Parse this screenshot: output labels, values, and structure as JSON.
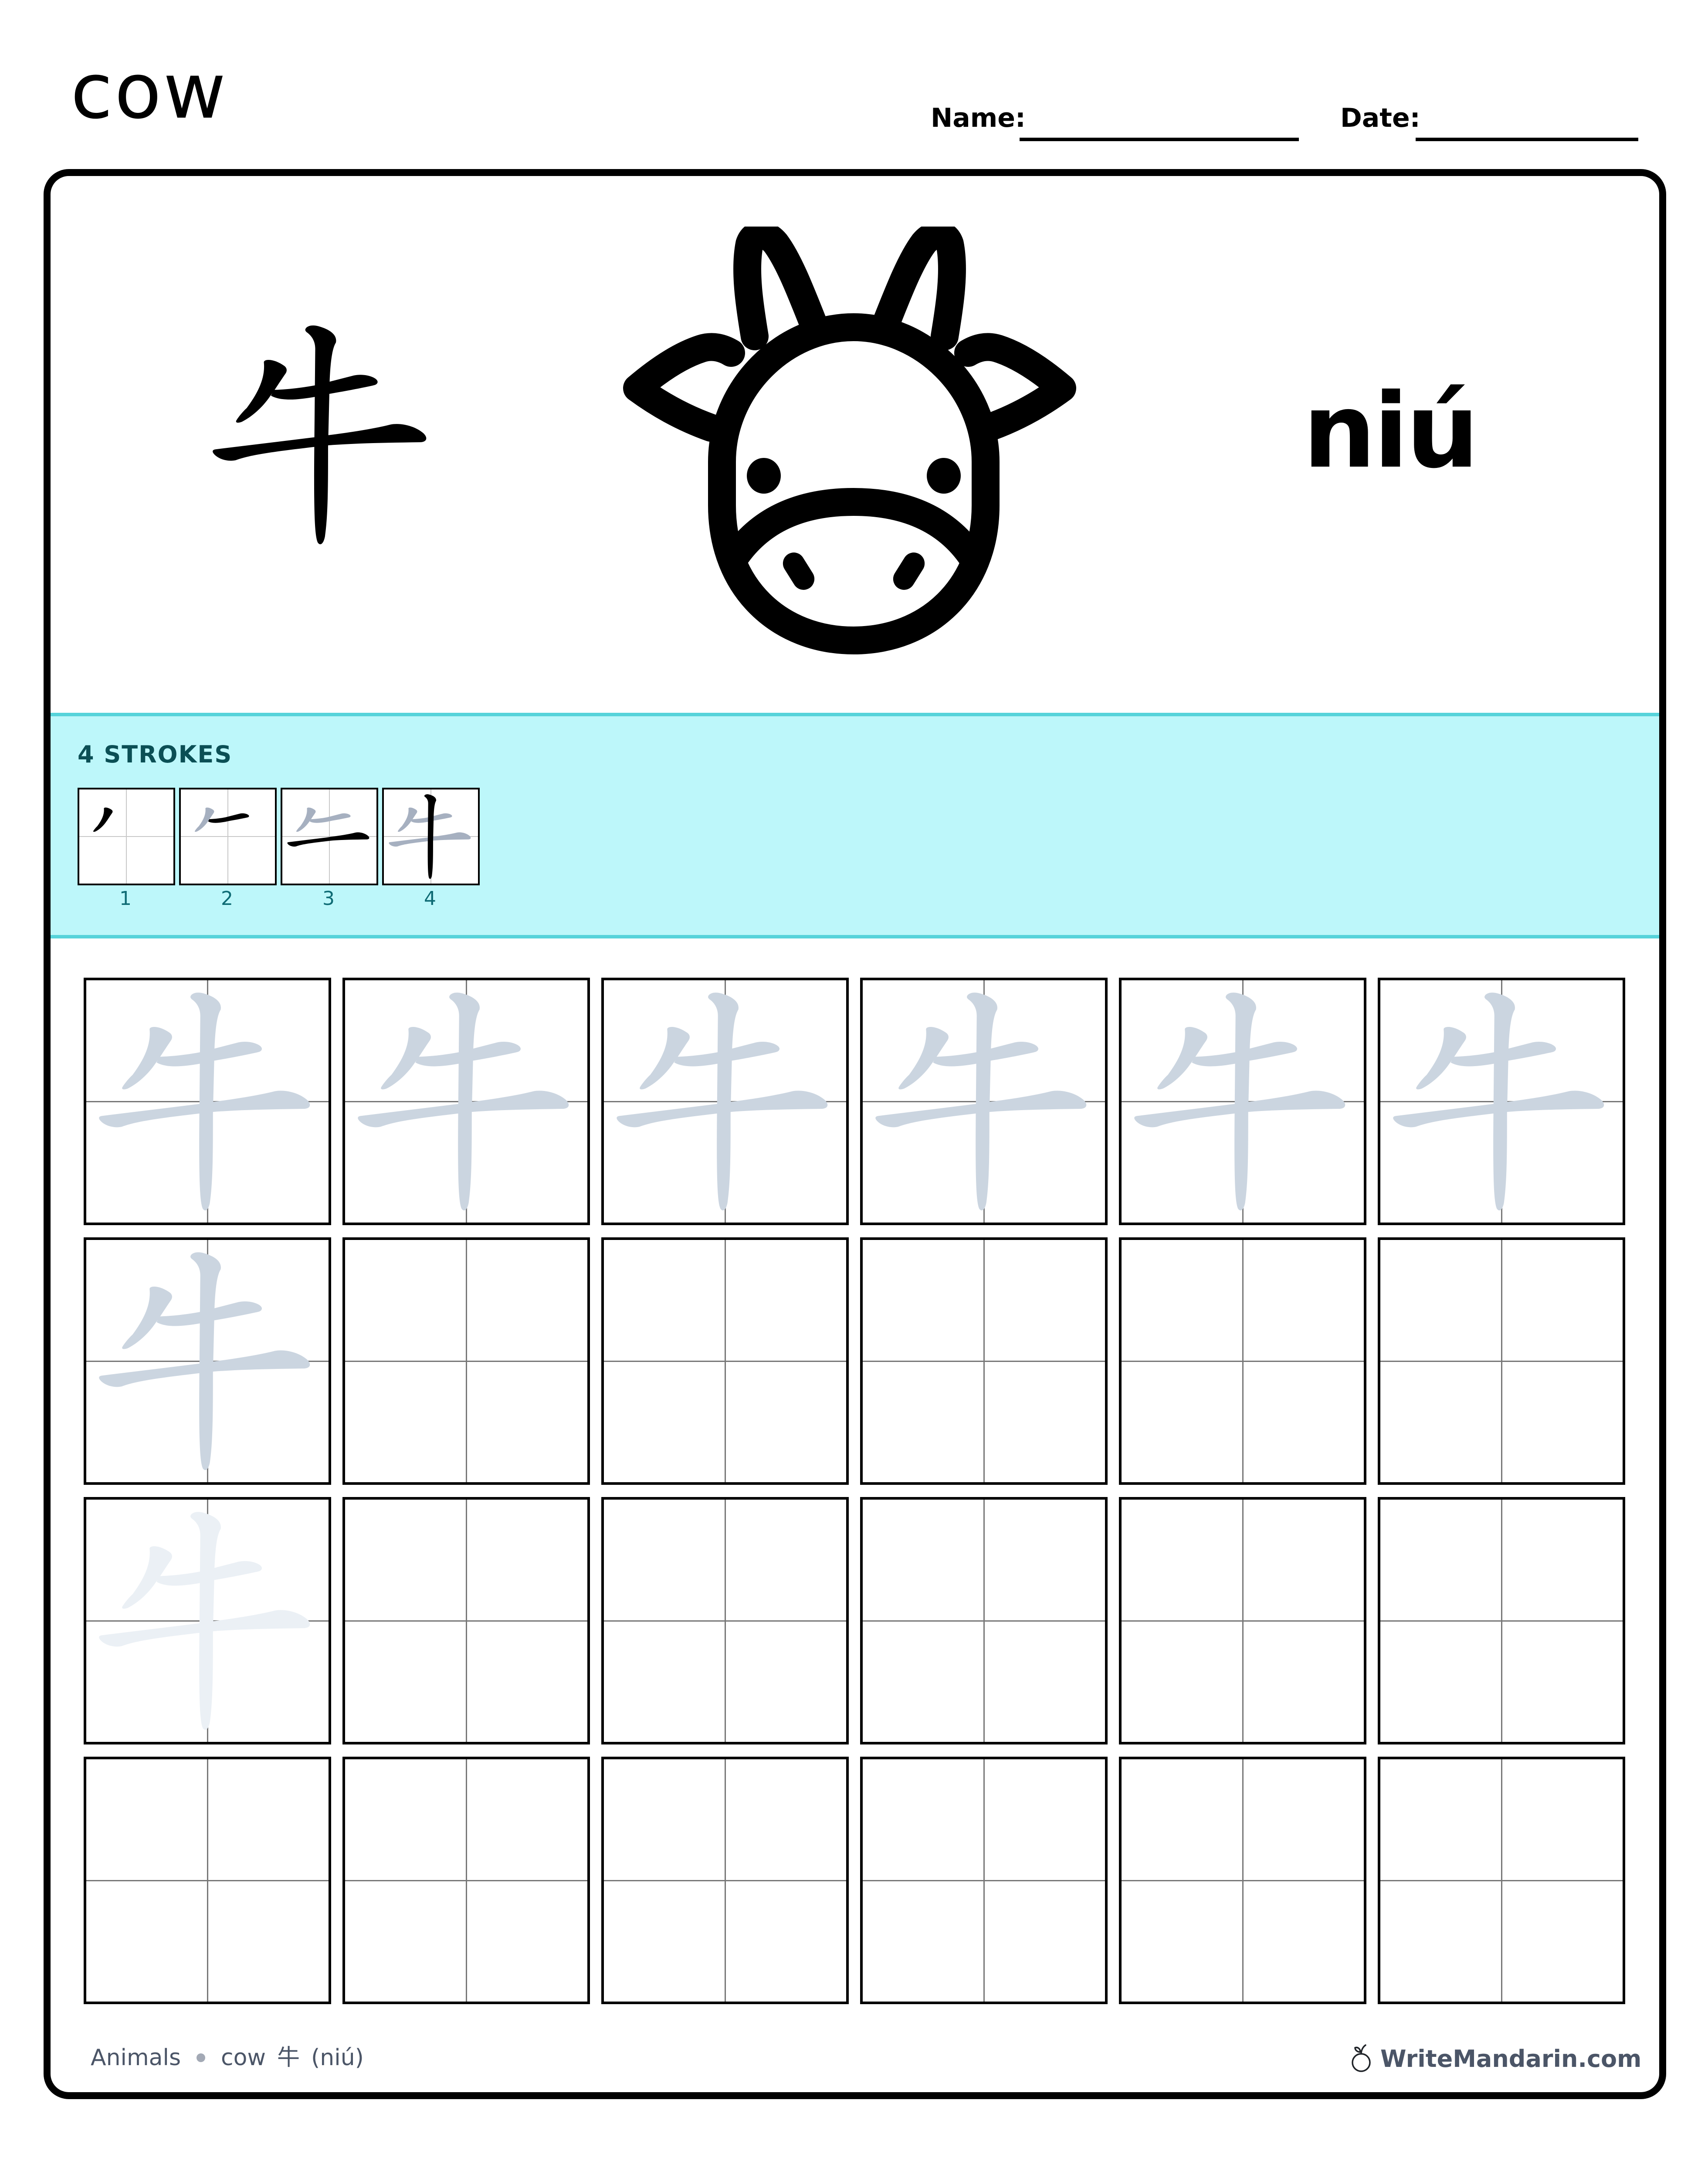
{
  "header": {
    "title": "cow",
    "name_label": "Name:",
    "date_label": "Date:"
  },
  "hero": {
    "character": "牛",
    "icon": "cow-face-icon",
    "pinyin": "niú"
  },
  "strokes": {
    "label": "4 STROKES",
    "count": 4,
    "steps": [
      {
        "number": "1"
      },
      {
        "number": "2"
      },
      {
        "number": "3"
      },
      {
        "number": "4"
      }
    ]
  },
  "practice_grid": {
    "rows": 4,
    "columns": 6,
    "character": "牛",
    "trace_cells": [
      {
        "row": 1,
        "col": 1,
        "style": "guide"
      },
      {
        "row": 1,
        "col": 2,
        "style": "guide"
      },
      {
        "row": 1,
        "col": 3,
        "style": "guide"
      },
      {
        "row": 1,
        "col": 4,
        "style": "guide"
      },
      {
        "row": 1,
        "col": 5,
        "style": "guide"
      },
      {
        "row": 1,
        "col": 6,
        "style": "guide"
      },
      {
        "row": 2,
        "col": 1,
        "style": "guide"
      },
      {
        "row": 3,
        "col": 1,
        "style": "faint"
      }
    ]
  },
  "footer": {
    "category": "Animals",
    "word": "cow",
    "character": "牛",
    "pinyin_paren": "(niú)",
    "brand": "WriteMandarin.com",
    "brand_icon": "plum-icon"
  },
  "colors": {
    "band_fill": "#bdf7fa",
    "band_border": "#56d3da",
    "strokes_label": "#0b4f55",
    "stroke_numbers": "#0e6b74",
    "guide_char": "#cbd5e0",
    "faint_char": "#ebf0f5",
    "stroke_previous": "#a6b0c0",
    "footer_text": "#4b5567"
  }
}
